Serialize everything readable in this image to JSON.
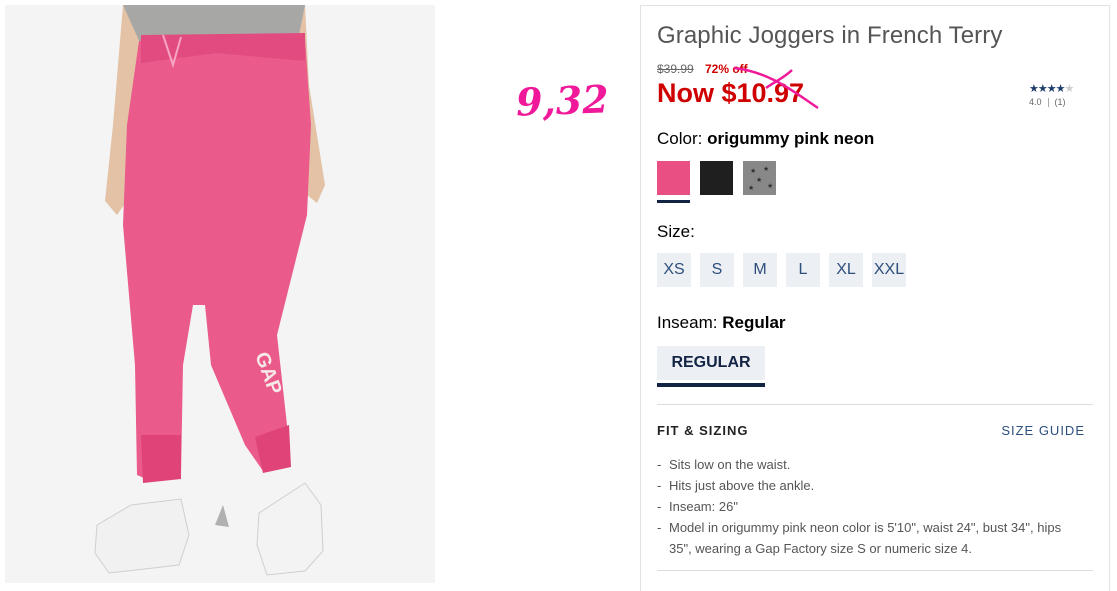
{
  "annotation": {
    "text": "9,32",
    "color": "#f0199a"
  },
  "product": {
    "title": "Graphic Joggers in French Terry",
    "original_price": "$39.99",
    "percent_off": "72% off",
    "now_price": "Now $10.97",
    "rating": {
      "stars": 4,
      "max_stars": 5,
      "score": "4.0",
      "count": "(1)"
    }
  },
  "color": {
    "label": "Color:",
    "selected": "origummy pink neon",
    "swatches": [
      {
        "name": "origummy pink neon",
        "hex": "#ea4f83",
        "selected": true
      },
      {
        "name": "black",
        "hex": "#1f1f1f",
        "selected": false
      },
      {
        "name": "grey star print",
        "hex": "#888888",
        "selected": false
      }
    ]
  },
  "size": {
    "label": "Size:",
    "options": [
      "XS",
      "S",
      "M",
      "L",
      "XL",
      "XXL"
    ]
  },
  "inseam": {
    "label": "Inseam:",
    "selected": "Regular",
    "button": "REGULAR"
  },
  "fit": {
    "heading": "FIT & SIZING",
    "size_guide": "SIZE GUIDE",
    "bullets": [
      "Sits low on the waist.",
      "Hits just above the ankle.",
      "Inseam: 26\"",
      "Model in origummy pink neon color is 5'10\", waist 24\", bust 34\", hips 35\", wearing a Gap Factory size S or numeric size 4."
    ]
  },
  "image": {
    "leg_logo": "GAP"
  },
  "colors": {
    "price_red": "#cf0000",
    "navy": "#122344",
    "link_blue": "#2c4f7c",
    "pants_pink": "#ea4f83"
  }
}
